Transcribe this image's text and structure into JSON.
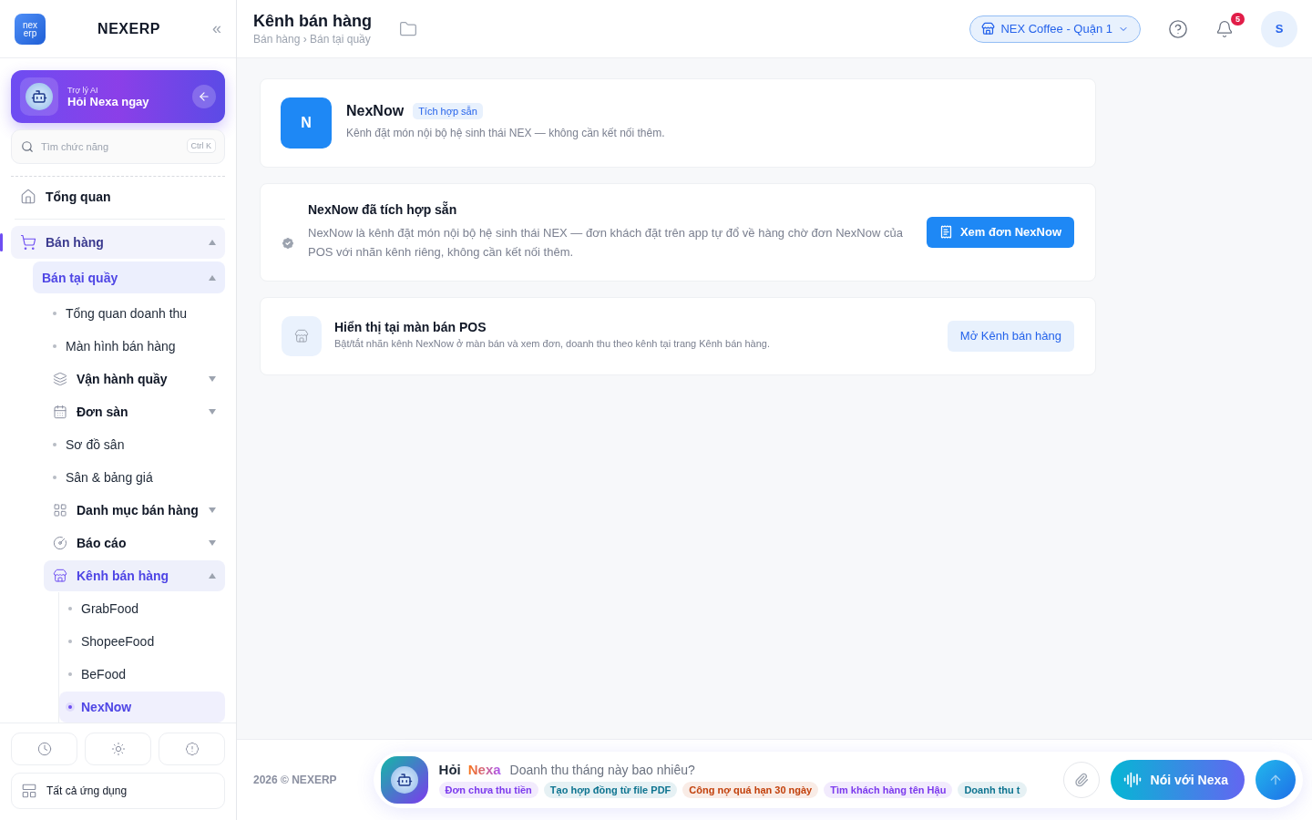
{
  "sidebar": {
    "logo_lines": [
      "nex",
      "erp"
    ],
    "brand": "NEXERP",
    "collapse_glyph": "«",
    "ai_card": {
      "caption": "Trợ lý AI",
      "title": "Hỏi Nexa ngay"
    },
    "search": {
      "placeholder": "Tìm chức năng",
      "shortcut": "Ctrl K"
    },
    "nav": [
      {
        "label": "Tổng quan",
        "kind": "top",
        "selected": false
      },
      {
        "label": "Bán hàng",
        "kind": "group",
        "selected": true,
        "expanded": true,
        "children": [
          {
            "label": "Bán tại quầy",
            "kind": "sub",
            "selected": true,
            "expanded": true,
            "children": [
              {
                "label": "Tổng quan doanh thu",
                "kind": "leaf",
                "selected": false
              },
              {
                "label": "Màn hình bán hàng",
                "kind": "leaf",
                "selected": false
              },
              {
                "label": "Vận hành quầy",
                "kind": "section",
                "selected": false,
                "expanded": false
              },
              {
                "label": "Đơn sàn",
                "kind": "section",
                "selected": false,
                "expanded": false
              },
              {
                "label": "Sơ đồ sân",
                "kind": "leaf",
                "selected": false
              },
              {
                "label": "Sân & bảng giá",
                "kind": "leaf",
                "selected": false
              },
              {
                "label": "Danh mục bán hàng",
                "kind": "section",
                "selected": false,
                "expanded": false
              },
              {
                "label": "Báo cáo",
                "kind": "section",
                "selected": false,
                "expanded": false
              },
              {
                "label": "Kênh bán hàng",
                "kind": "section",
                "selected": true,
                "expanded": true,
                "children": [
                  {
                    "label": "GrabFood",
                    "kind": "leaf",
                    "selected": false
                  },
                  {
                    "label": "ShopeeFood",
                    "kind": "leaf",
                    "selected": false
                  },
                  {
                    "label": "BeFood",
                    "kind": "leaf",
                    "selected": false
                  },
                  {
                    "label": "NexNow",
                    "kind": "leaf",
                    "selected": true
                  }
                ]
              }
            ]
          }
        ]
      }
    ],
    "all_apps": "Tất cả ứng dụng"
  },
  "header": {
    "title": "Kênh bán hàng",
    "breadcrumb": "Bán hàng › Bán tại quầy",
    "branch": "NEX Coffee - Quận 1",
    "notifications": "5",
    "avatar": "S"
  },
  "intro_card": {
    "logo": "N",
    "name": "NexNow",
    "badge": "Tích hợp sẵn",
    "description": "Kênh đặt món nội bộ hệ sinh thái NEX — không cần kết nối thêm."
  },
  "status_card": {
    "title": "NexNow đã tích hợp sẵn",
    "text": "NexNow là kênh đặt món nội bộ hệ sinh thái NEX — đơn khách đặt trên app tự đổ về hàng chờ đơn NexNow của POS với nhãn kênh riêng, không cần kết nối thêm.",
    "button": "Xem đơn NexNow"
  },
  "pos_card": {
    "title": "Hiển thị tại màn bán POS",
    "text": "Bật/tắt nhãn kênh NexNow ở màn bán và xem đơn, doanh thu theo kênh tại trang Kênh bán hàng.",
    "button": "Mở Kênh bán hàng"
  },
  "footer": {
    "copyright": "2026 © NEXERP",
    "assistant": {
      "ask": "Hỏi",
      "name": "Nexa",
      "placeholder": "Doanh thu tháng này bao nhiêu?",
      "voice_button": "Nói với Nexa",
      "suggestions": [
        {
          "label": "Đơn chưa thu tiền",
          "color": "#7c3aed"
        },
        {
          "label": "Tạo hợp đồng từ file PDF",
          "color": "#0e7490"
        },
        {
          "label": "Công nợ quá hạn 30 ngày",
          "color": "#c2410c"
        },
        {
          "label": "Tìm khách hàng tên Hậu",
          "color": "#7c3aed"
        },
        {
          "label": "Doanh thu t",
          "color": "#0e7490"
        }
      ]
    }
  }
}
